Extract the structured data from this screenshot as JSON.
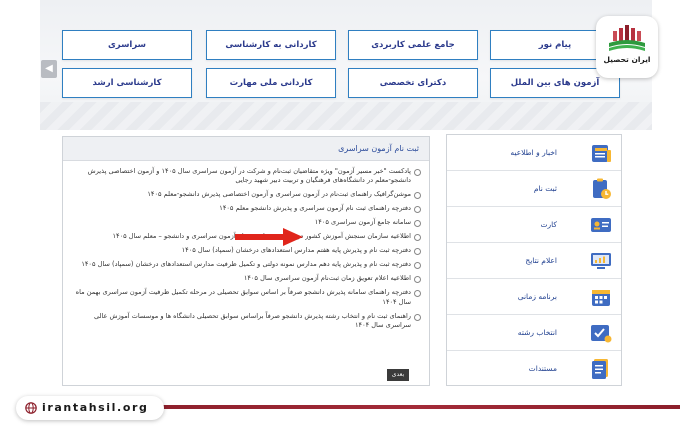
{
  "logo": {
    "text": "ایران تحصیل"
  },
  "top_buttons": [
    "سراسری",
    "کاردانی به کارشناسی",
    "جامع علمی کاربردی",
    "پیام نور",
    "کارشناسی ارشد",
    "کاردانی ملی مهارت",
    "دکترای تخصصی",
    "آزمون های بین الملل"
  ],
  "panel": {
    "title": "ثبت نام آزمون سراسری",
    "items": [
      "پادکست \"خبر مسیر آزمون\" ویژه متقاضیان ثبت‌نام و شرکت در آزمون سراسری سال ۱۴۰۵ و آزمون اختصاصی پذیرش دانشجو-معلم در دانشگاه‌های فرهنگیان و تربیت دبیر شهید رجایی",
      "موشن‌گرافیک راهنمای ثبت‌نام در آزمون سراسری و آزمون اختصاصی پذیرش دانشجو-معلم ۱۴۰۵",
      "دفترچه راهنمای ثبت نام آزمون سراسری و پذیرش دانشجو معلم ۱۴۰۵",
      "سامانه جامع آزمون سراسری ۱۴۰۵",
      "اطلاعیه سازمان سنجش آموزش کشور در خصوص زمان ثبت‌نام آزمون سراسری و دانشجو – معلم سال ۱۴۰۵",
      "دفترچه ثبت نام و پذیرش پایه هفتم مدارس استعدادهای درخشان (سمپاد) سال ۱۴۰۵",
      "دفترچه ثبت نام و پذیرش پایه دهم مدارس نمونه دولتی و تکمیل ظرفیت مدارس استعدادهای درخشان (سمپاد) سال ۱۴۰۵",
      "اطلاعیه اعلام تعویق زمان ثبت‌نام آزمون سراسری سال ۱۴۰۵",
      "دفترچه راهنمای سامانه پذیرش دانشجو صرفاً بر اساس سوابق تحصیلی در مرحله تکمیل ظرفیت آزمون سراسری بهمن ماه سال ۱۴۰۴",
      "راهنمای ثبت نام و انتخاب رشته پذیرش دانشجو صرفاً براساس سوابق تحصیلی دانشگاه ها و موسسات آموزش عالی سراسری سال ۱۴۰۴"
    ],
    "more_label": "بعدی"
  },
  "menu": {
    "items": [
      {
        "label": "اخبار و اطلاعیه",
        "icon": "news-icon"
      },
      {
        "label": "ثبت نام",
        "icon": "registration-icon"
      },
      {
        "label": "کارت",
        "icon": "card-icon"
      },
      {
        "label": "اعلام نتایج",
        "icon": "results-icon"
      },
      {
        "label": "برنامه زمانی",
        "icon": "calendar-icon"
      },
      {
        "label": "انتخاب رشته",
        "icon": "field-selection-icon"
      },
      {
        "label": "مستندات",
        "icon": "documents-icon"
      }
    ]
  },
  "footer": {
    "site": "irantahsil.org"
  },
  "colors": {
    "button_border": "#2f7fc1",
    "button_text": "#2b3a8c",
    "link": "#1f3f8f",
    "arrow": "#e0251b",
    "footer_bar": "#a32b38"
  }
}
